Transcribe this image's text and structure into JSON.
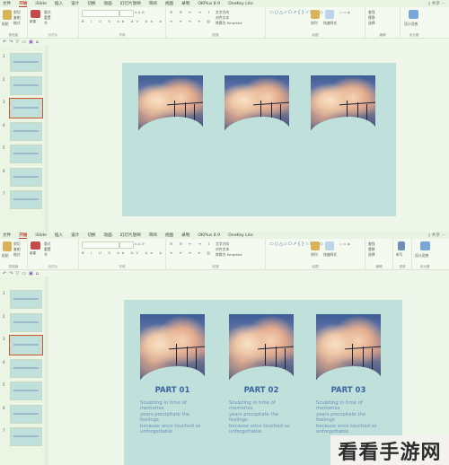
{
  "menu": {
    "items": [
      "文件",
      "开始",
      "iSlide",
      "插入",
      "设计",
      "切换",
      "动画",
      "幻灯片放映",
      "审阅",
      "视图",
      "录制",
      "OKPlus 8.9",
      "OneKey Lite"
    ],
    "active_index": 1,
    "right_1": "▯ 共享  ⋯",
    "right_2": "▯ 共享  ⋯"
  },
  "ribbon": {
    "paste": "粘贴",
    "new_slide": "新建\n幻灯片",
    "cut": "剪切",
    "copy": "复制",
    "format": "格式",
    "layout": "版式",
    "reset": "重置",
    "section": "节",
    "clipboard_label": "剪贴板",
    "slides_label": "幻灯片",
    "font_label": "字体",
    "paragraph_label": "段落",
    "drawing_label": "绘图",
    "editing_label": "编辑",
    "text_direction": "文字方向",
    "align_text": "对齐文本",
    "convert_smartart": "转换为 SmartArt",
    "arrange": "排列",
    "quick_styles": "快速样式",
    "find": "查找",
    "replace": "替换",
    "select": "选择",
    "voice": "听写",
    "voice_label": "语音",
    "design_ideas": "设计灵感",
    "designer_label": "设计器"
  },
  "slides": {
    "numbers": [
      "1",
      "2",
      "3",
      "4",
      "5",
      "6",
      "7"
    ],
    "selected_index": 2
  },
  "slide2": {
    "parts": [
      {
        "title": "PART 01",
        "text": "Sculpting in time of memories\nyears precipitate the feelings\nbecause once touched so\nunforgettable."
      },
      {
        "title": "PART 02",
        "text": "Sculpting in time of memories\nyears precipitate the feelings\nbecause once touched so\nunforgettable."
      },
      {
        "title": "PART 03",
        "text": "Sculpting in time of memories\nyears precipitate the feelings\nbecause once touched so\nunforgettable."
      }
    ]
  },
  "watermark": {
    "text": "看看手游网"
  },
  "colors": {
    "background": "#eef7e9",
    "slide_background": "#bfe0db",
    "accent_tab": "#c0392b",
    "part_title": "#3c64a0",
    "part_text": "#6a8fb8"
  }
}
